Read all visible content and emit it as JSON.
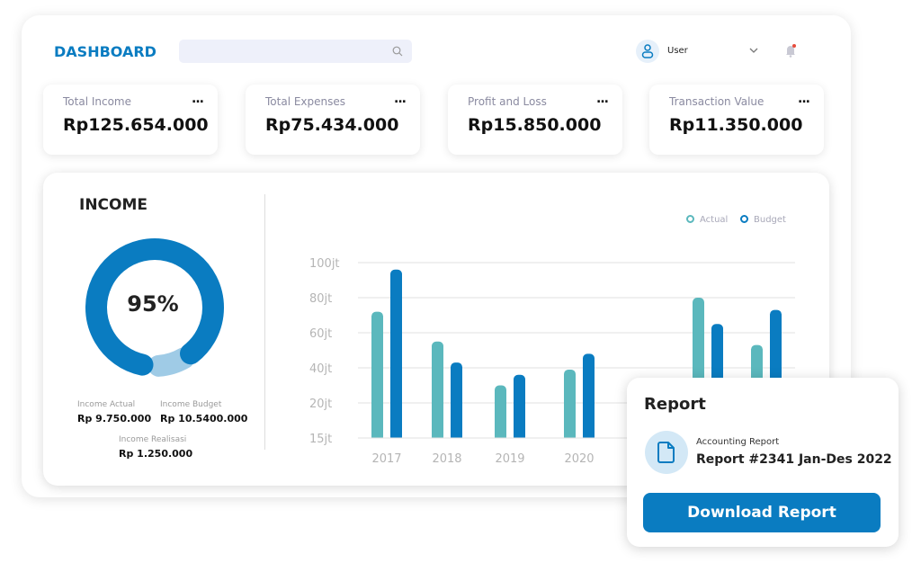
{
  "header": {
    "title": "DASHBOARD",
    "search_placeholder": "",
    "user": "User",
    "icons": {
      "search": "search-icon",
      "user": "user-icon",
      "chevron": "chevron-down-icon",
      "bell": "bell-icon"
    }
  },
  "cards": [
    {
      "label": "Total Income",
      "value": "Rp125.654.000",
      "menu": "..."
    },
    {
      "label": "Total Expenses",
      "value": "Rp75.434.000",
      "menu": "..."
    },
    {
      "label": "Profit and Loss",
      "value": "Rp15.850.000",
      "menu": "..."
    },
    {
      "label": "Transaction Value",
      "value": "Rp11.350.000",
      "menu": "..."
    }
  ],
  "income": {
    "title": "INCOME",
    "percent": "95%",
    "percent_value": 95,
    "stats": [
      {
        "label": "Income Actual",
        "value": "Rp 9.750.000"
      },
      {
        "label": "Income Budget",
        "value": "Rp 10.5400.000"
      },
      {
        "label": "Income Realisasi",
        "value": "Rp 1.250.000"
      }
    ],
    "colors": {
      "main": "#0a7cc1",
      "secondary": "#9fcbe6"
    }
  },
  "chart_data": {
    "type": "bar",
    "categories": [
      "2017",
      "2018",
      "2019",
      "2020",
      "",
      ""
    ],
    "series": [
      {
        "name": "Actual",
        "color": "#5bb8bd",
        "values": [
          72,
          55,
          30,
          39,
          80,
          53
        ]
      },
      {
        "name": "Budget",
        "color": "#0a7cc1",
        "values": [
          96,
          43,
          36,
          48,
          65,
          73
        ]
      }
    ],
    "yticks": [
      15,
      20,
      40,
      60,
      80,
      100
    ],
    "ytick_labels": [
      "15jt",
      "20jt",
      "40jt",
      "60jt",
      "80jt",
      "100jt"
    ],
    "ylim": [
      15,
      100
    ],
    "grid": true,
    "legend": "top-right"
  },
  "report": {
    "title": "Report",
    "subtitle": "Accounting Report",
    "name": "Report #2341 Jan-Des 2022",
    "button": "Download Report",
    "icon": "document-icon"
  }
}
